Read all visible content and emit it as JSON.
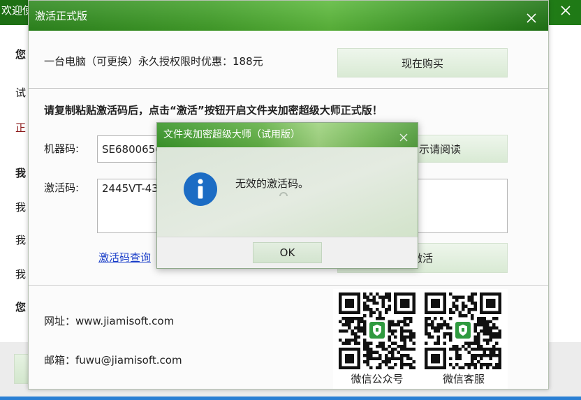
{
  "background_window": {
    "title": "欢迎使",
    "side_chars": [
      "您",
      "试",
      "正",
      "我",
      "我",
      "我",
      "我",
      "您"
    ]
  },
  "activation_dialog": {
    "title": "激活正式版",
    "offer_text": "一台电脑（可更换）永久授权限时优惠：188元",
    "buy_button": "现在购买",
    "instruction": "请复制粘贴激活码后，点击“激活”按钮开启文件夹加密超级大师正式版！",
    "machine_code_label": "机器码:",
    "machine_code_value": "SE6800656",
    "hint_button": "示请阅读",
    "activation_code_label": "激活码:",
    "activation_code_value": "2445VT-43",
    "query_link": "激活码查询",
    "activate_button": "激活",
    "website": "网址：www.jiamisoft.com",
    "email": "邮箱：fuwu@jiamisoft.com",
    "qr_codes": [
      {
        "label": "微信公众号"
      },
      {
        "label": "微信客服"
      }
    ]
  },
  "message_box": {
    "title": "文件夹加密超级大师（试用版）",
    "message": "无效的激活码。",
    "ok_button": "OK",
    "icon": "info-icon"
  },
  "icons": {
    "close": "close-icon",
    "info": "info-icon",
    "busy": "busy-cursor-icon",
    "qr_logo": "qr-logo-icon"
  },
  "colors": {
    "title_green": "#2e8b1e",
    "button_green": "#dcebd7",
    "link_blue": "#1b3fc9",
    "info_blue": "#1c6cc4",
    "highlight_red": "#8b1a1a",
    "taskbar_blue": "#2a7fd4"
  }
}
